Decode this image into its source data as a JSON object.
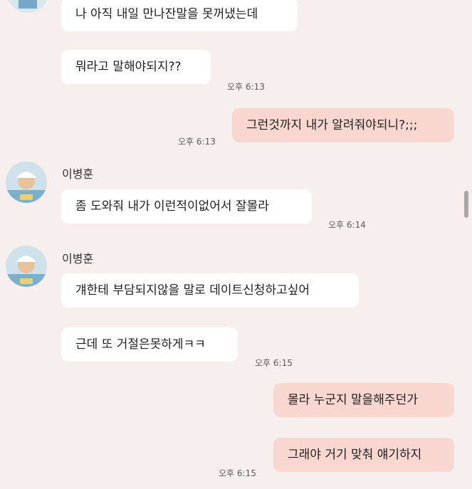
{
  "chat": {
    "messages": [
      {
        "text": "나 아직 내일 만나잔말을 못꺼냈는데"
      },
      {
        "text": "뭐라고 말해야되지??",
        "time": "오후 6:13"
      },
      {
        "text": "그런것까지 내가 알려줘야되니?;;;",
        "time": "오후 6:13"
      },
      {
        "sender": "이병훈",
        "text": "좀 도와줘 내가 이런적이없어서 잘몰라",
        "time": "오후 6:14"
      },
      {
        "sender": "이병훈",
        "text": "걔한테 부담되지않을 말로 데이트신청하고싶어"
      },
      {
        "text": "근데 또 거절은못하게ㅋㅋ",
        "time": "오후 6:15"
      },
      {
        "text": "몰라 누군지 말을해주던가"
      },
      {
        "text": "그래야 거기 맞춰 얘기하지",
        "time": "오후 6:15"
      }
    ]
  },
  "colors": {
    "background": "#f6efed",
    "incoming_bubble": "#ffffff",
    "outgoing_bubble": "#f8d7d1"
  },
  "icons": {
    "avatar": "profile-photo-icon"
  }
}
